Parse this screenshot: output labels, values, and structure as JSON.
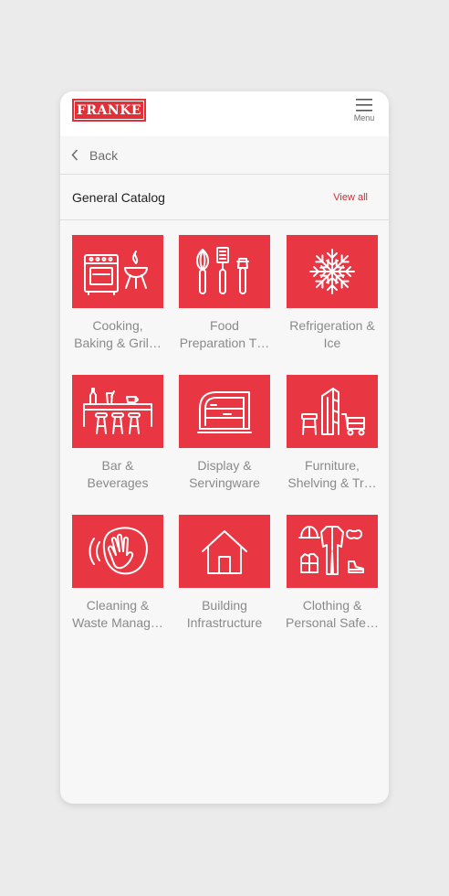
{
  "brand": {
    "logo_text": "FRANKE"
  },
  "header": {
    "menu_label": "Menu"
  },
  "nav": {
    "back_label": "Back"
  },
  "catalog": {
    "title": "General Catalog",
    "view_all_label": "View all"
  },
  "categories": [
    {
      "line1": "Cooking,",
      "line2": "Baking & Gril…",
      "icon": "cooking-icon"
    },
    {
      "line1": "Food",
      "line2": "Preparation T…",
      "icon": "food-preparation-icon"
    },
    {
      "line1": "Refrigeration &",
      "line2": "Ice",
      "icon": "snowflake-icon"
    },
    {
      "line1": "Bar &",
      "line2": "Beverages",
      "icon": "bar-icon"
    },
    {
      "line1": "Display &",
      "line2": "Servingware",
      "icon": "display-case-icon"
    },
    {
      "line1": "Furniture,",
      "line2": "Shelving & Tr…",
      "icon": "furniture-icon"
    },
    {
      "line1": "Cleaning &",
      "line2": "Waste Manag…",
      "icon": "cleaning-hand-icon"
    },
    {
      "line1": "Building",
      "line2": "Infrastructure",
      "icon": "house-icon"
    },
    {
      "line1": "Clothing &",
      "line2": "Personal Safe…",
      "icon": "clothing-icon"
    }
  ],
  "colors": {
    "accent": "#e83642",
    "link": "#d42a31",
    "background": "#f7f7f7"
  }
}
